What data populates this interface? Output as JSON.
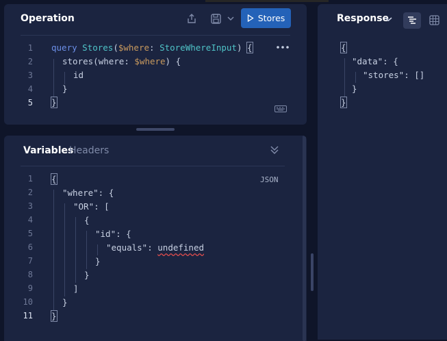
{
  "operation": {
    "title": "Operation",
    "run_label": "Stores",
    "share_icon": "share-icon",
    "save_icon": "save-icon",
    "more_icon": "more-icon",
    "keyboard_icon": "keyboard-icon",
    "line_numbers": [
      "1",
      "2",
      "3",
      "4",
      "5"
    ],
    "query": {
      "l1_kw": "query",
      "l1_name": "Stores",
      "l1_open": "(",
      "l1_var": "$where",
      "l1_colon": ":",
      "l1_type": "StoreWhereInput",
      "l1_close": ")",
      "l1_brace": "{",
      "l2_field": "stores",
      "l2_open": "(",
      "l2_arg": "where",
      "l2_colon": ":",
      "l2_var": "$where",
      "l2_close": ")",
      "l2_brace": "{",
      "l3_field": "id",
      "l4_brace": "}",
      "l5_brace": "}"
    }
  },
  "variables": {
    "tab_variables": "Variables",
    "tab_headers": "Headers",
    "collapse_icon": "chevrons-down-icon",
    "badge": "JSON",
    "line_numbers": [
      "1",
      "2",
      "3",
      "4",
      "5",
      "6",
      "7",
      "8",
      "9",
      "10",
      "11"
    ],
    "lines": [
      "{",
      "\"where\": {",
      "\"OR\": [",
      "{",
      "\"id\": {",
      "\"equals\": ",
      "}",
      "}",
      "]",
      "}",
      "}"
    ],
    "error_token": "undefined"
  },
  "response": {
    "title": "Response",
    "lines": [
      "{",
      "\"data\": {",
      "\"stores\": []",
      "}",
      "}"
    ]
  }
}
